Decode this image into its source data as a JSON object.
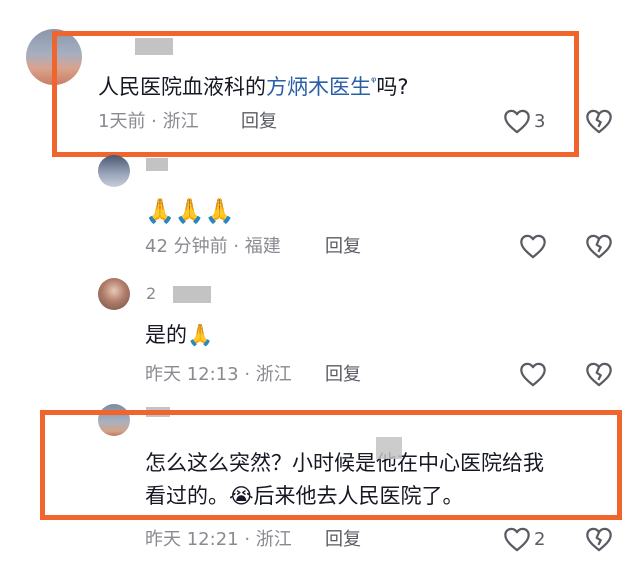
{
  "comments": [
    {
      "text_before": "人民医院血液科的",
      "link_text": "方炳木医生",
      "search_glyph": "ᵠ",
      "text_after": "吗?",
      "meta": "1天前 · 浙江",
      "reply_label": "回复",
      "likes": "3"
    },
    {
      "emoji": "🙏🙏🙏",
      "meta": "42 分钟前 · 福建",
      "reply_label": "回复"
    },
    {
      "username_fragment": "2",
      "text": "是的🙏",
      "meta": "昨天 12:13 · 浙江",
      "reply_label": "回复"
    },
    {
      "line1": "怎么这么突然？小时候是他在中心医院给我",
      "line2": "看过的。😭后来他去人民医院了。",
      "meta": "昨天 12:21 · 浙江",
      "reply_label": "回复",
      "likes": "2"
    }
  ],
  "colors": {
    "highlight": "#f0642e",
    "link": "#2a5fa8",
    "meta": "#8a8b91"
  },
  "icons": {
    "like": "heart-outline-icon",
    "dislike": "broken-heart-icon"
  }
}
